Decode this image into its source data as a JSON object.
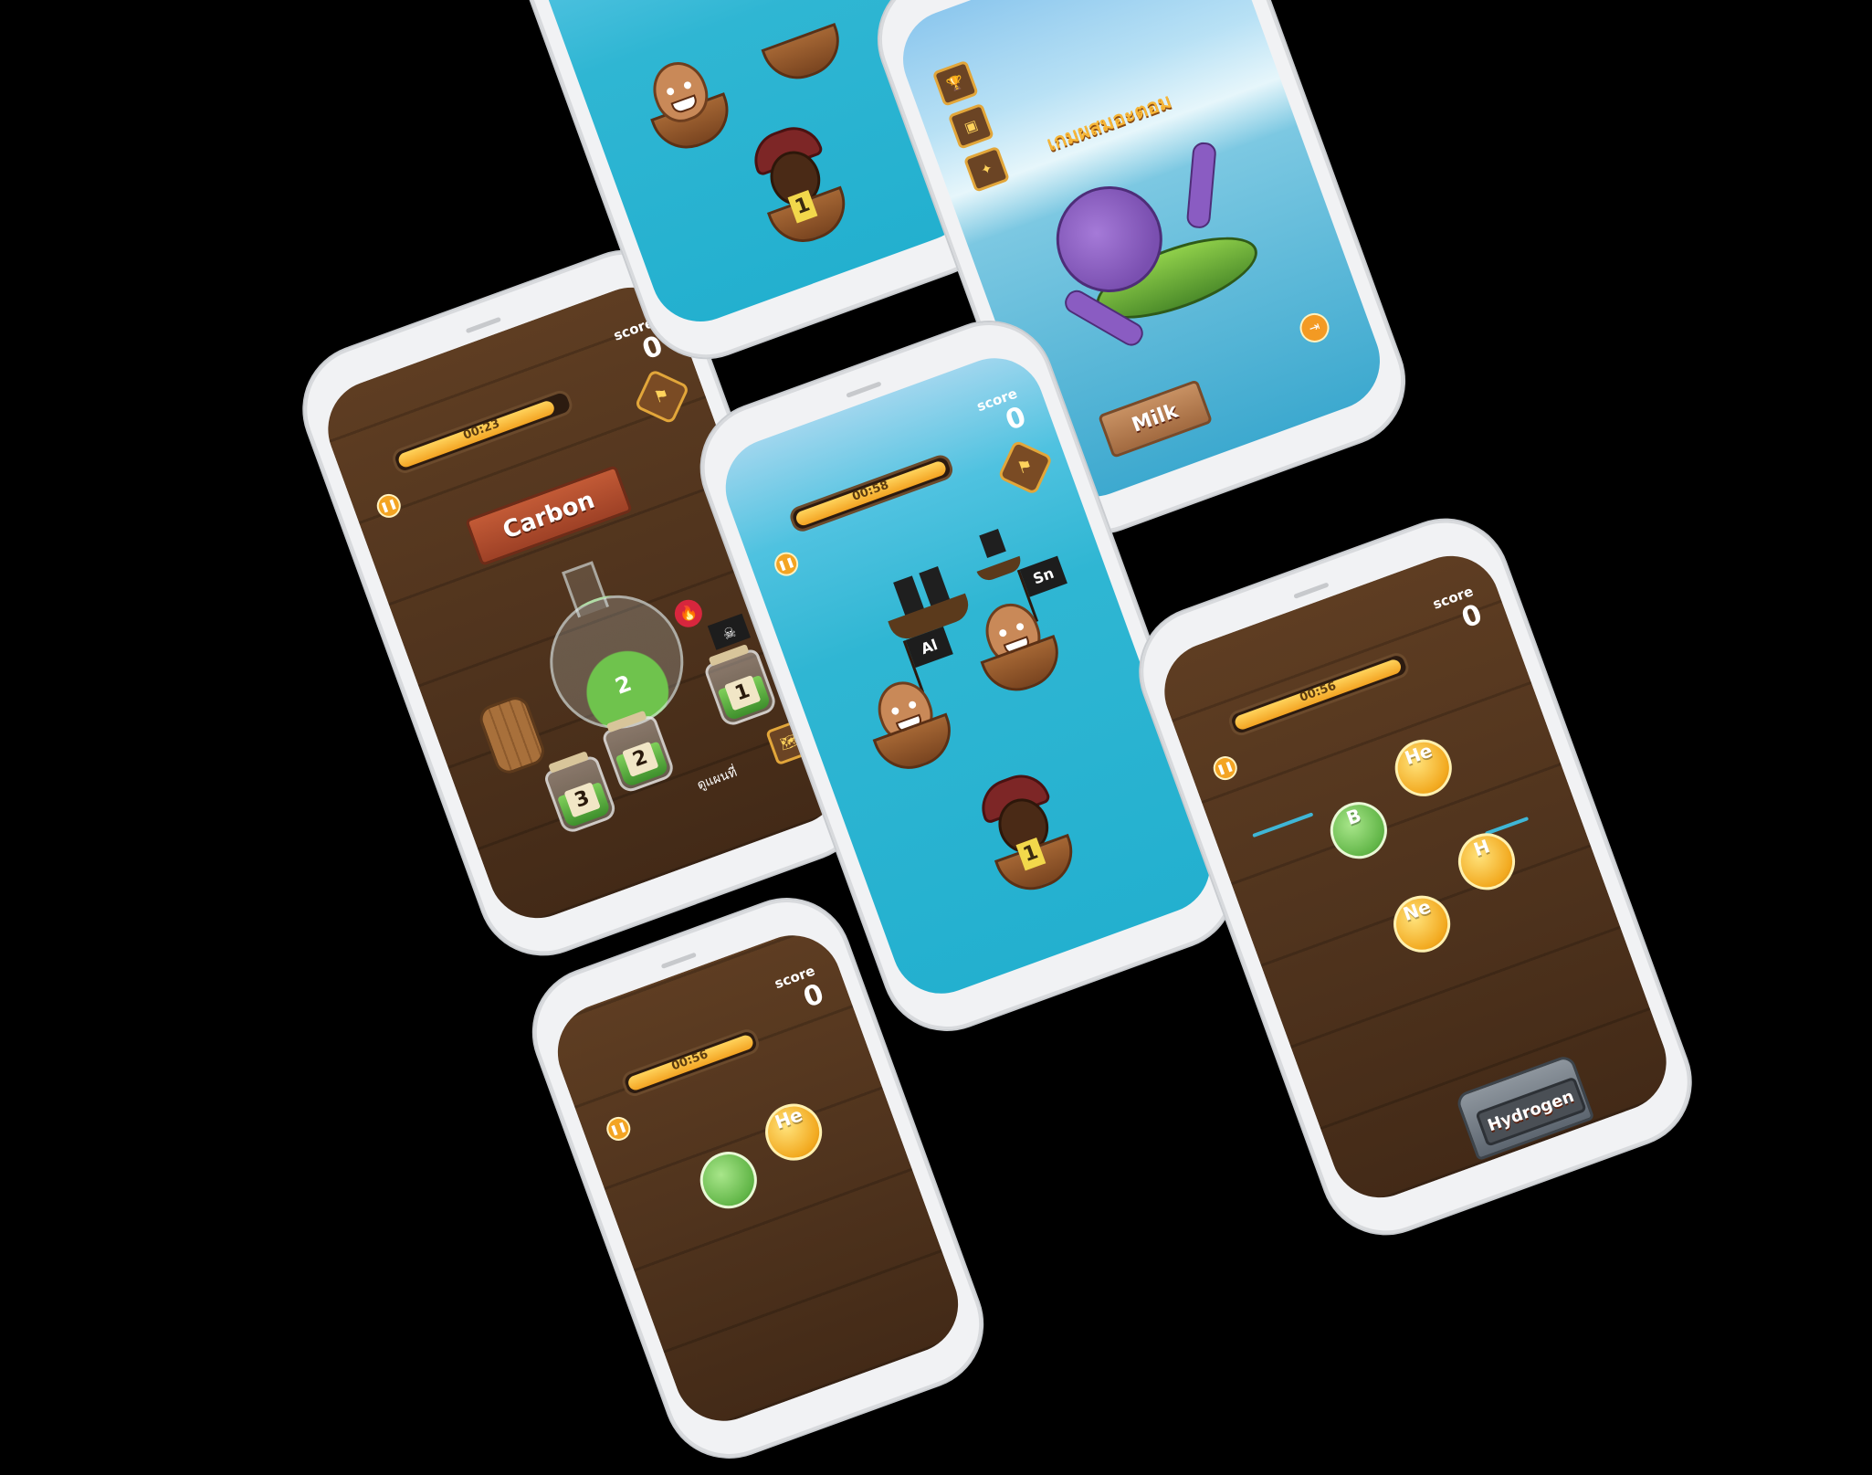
{
  "screens": {
    "carbon": {
      "score_label": "score",
      "score_value": "0",
      "timer": "00:23",
      "element_name": "Carbon",
      "flask_number": "2",
      "jars": [
        "3",
        "2",
        "1"
      ],
      "hint": "ดูแผนที่",
      "pause_icon": "pause-icon",
      "badge_icon": "treasure-map-icon"
    },
    "sea_top": {
      "number_tag": "1"
    },
    "menu": {
      "title": "เกมผสมอะตอม",
      "menu_icons": [
        "trophy-icon",
        "treasure-chest-icon",
        "map-icon"
      ],
      "start_button": "Milk",
      "exit_icon": "exit-icon"
    },
    "pirates": {
      "score_label": "score",
      "score_value": "0",
      "timer": "00:58",
      "flags": [
        "Sn",
        "Al"
      ],
      "number_tag": "1"
    },
    "shelf_right": {
      "score_label": "score",
      "score_value": "0",
      "timer": "00:56",
      "coins": [
        "He",
        "B",
        "H",
        "Ne"
      ],
      "chest_label": "Hydrogen"
    },
    "shelf_bottom": {
      "score_label": "score",
      "score_value": "0",
      "timer": "00:56",
      "coins": [
        "He"
      ]
    }
  }
}
